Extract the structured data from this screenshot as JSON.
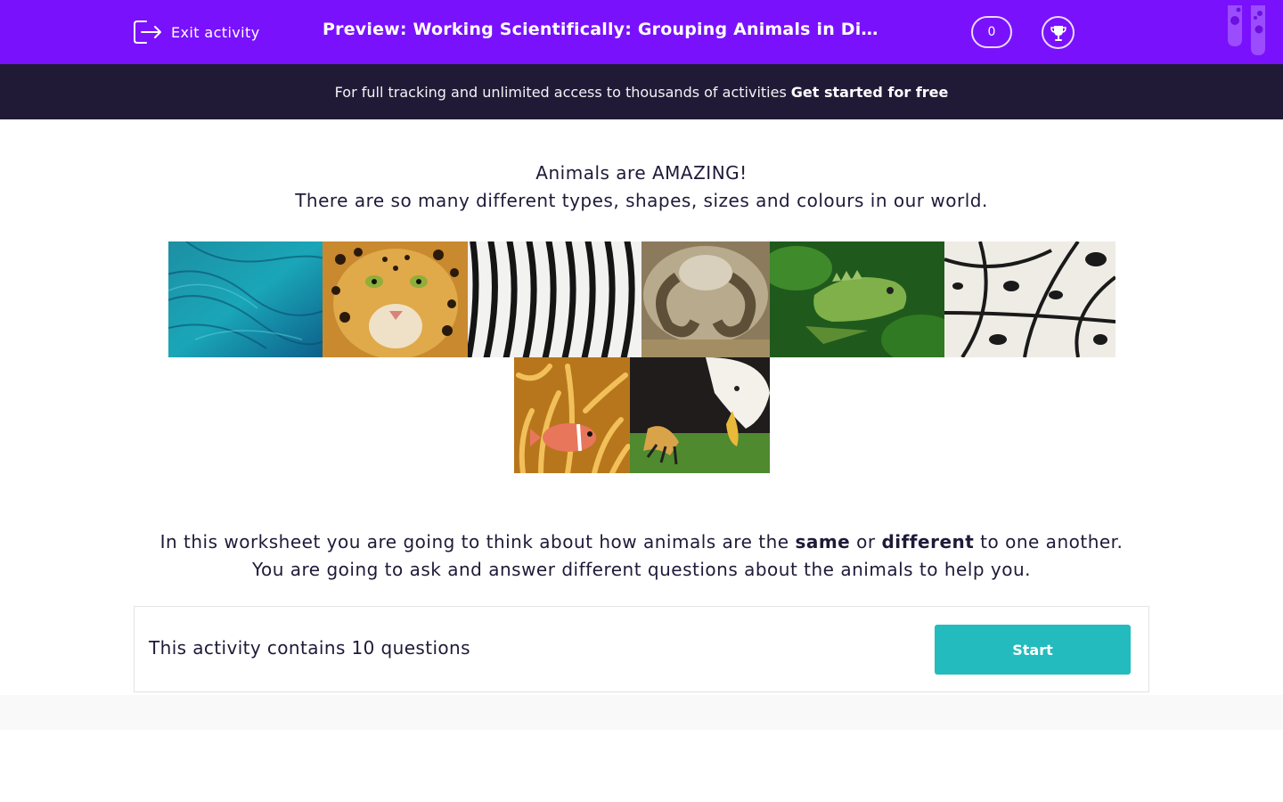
{
  "header": {
    "exit_label": "Exit activity",
    "title": "Preview: Working Scientifically: Grouping Animals in Differ...",
    "score_count": "0",
    "icons": [
      "exit-icon",
      "trophy-icon",
      "test-tubes-icon"
    ]
  },
  "promo": {
    "text": "For full tracking and unlimited access to thousands of activities",
    "link_label": "Get started for free"
  },
  "intro": {
    "line1": "Animals are AMAZING!",
    "line2": "There are so many different types, shapes, sizes and colours in our world."
  },
  "images": [
    "macaw-feathers",
    "leopard-face",
    "zebra-stripes",
    "ram-horns",
    "green-iguana",
    "butterfly-wing",
    "clownfish-anemone",
    "bald-eagle"
  ],
  "description": {
    "line1_a": "In this worksheet you are going to think about how animals are the",
    "same": "same",
    "or": "or",
    "different": "different",
    "line1_b": "to one another.",
    "line2": "You are going to ask and answer different questions about the animals to help you."
  },
  "activity": {
    "contains_text": "This activity contains 10 questions",
    "start_label": "Start"
  },
  "colors": {
    "brand_purple": "#7a11fd",
    "promo_bg": "#211a37",
    "start_teal": "#23bbbd"
  }
}
